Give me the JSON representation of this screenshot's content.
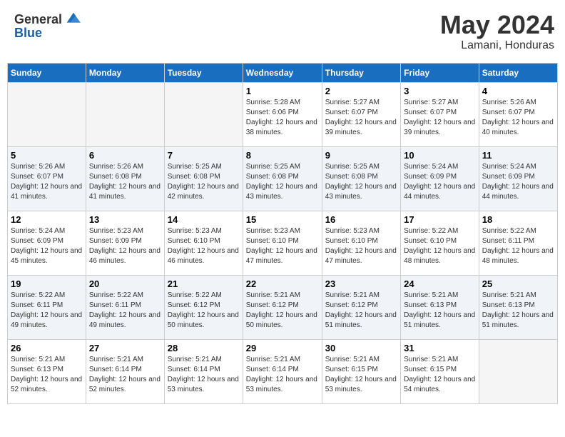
{
  "header": {
    "logo_general": "General",
    "logo_blue": "Blue",
    "month": "May 2024",
    "location": "Lamani, Honduras"
  },
  "weekdays": [
    "Sunday",
    "Monday",
    "Tuesday",
    "Wednesday",
    "Thursday",
    "Friday",
    "Saturday"
  ],
  "weeks": [
    [
      {
        "day": "",
        "sunrise": "",
        "sunset": "",
        "daylight": "",
        "empty": true
      },
      {
        "day": "",
        "sunrise": "",
        "sunset": "",
        "daylight": "",
        "empty": true
      },
      {
        "day": "",
        "sunrise": "",
        "sunset": "",
        "daylight": "",
        "empty": true
      },
      {
        "day": "1",
        "sunrise": "5:28 AM",
        "sunset": "6:06 PM",
        "daylight": "12 hours and 38 minutes."
      },
      {
        "day": "2",
        "sunrise": "5:27 AM",
        "sunset": "6:07 PM",
        "daylight": "12 hours and 39 minutes."
      },
      {
        "day": "3",
        "sunrise": "5:27 AM",
        "sunset": "6:07 PM",
        "daylight": "12 hours and 39 minutes."
      },
      {
        "day": "4",
        "sunrise": "5:26 AM",
        "sunset": "6:07 PM",
        "daylight": "12 hours and 40 minutes."
      }
    ],
    [
      {
        "day": "5",
        "sunrise": "5:26 AM",
        "sunset": "6:07 PM",
        "daylight": "12 hours and 41 minutes."
      },
      {
        "day": "6",
        "sunrise": "5:26 AM",
        "sunset": "6:08 PM",
        "daylight": "12 hours and 41 minutes."
      },
      {
        "day": "7",
        "sunrise": "5:25 AM",
        "sunset": "6:08 PM",
        "daylight": "12 hours and 42 minutes."
      },
      {
        "day": "8",
        "sunrise": "5:25 AM",
        "sunset": "6:08 PM",
        "daylight": "12 hours and 43 minutes."
      },
      {
        "day": "9",
        "sunrise": "5:25 AM",
        "sunset": "6:08 PM",
        "daylight": "12 hours and 43 minutes."
      },
      {
        "day": "10",
        "sunrise": "5:24 AM",
        "sunset": "6:09 PM",
        "daylight": "12 hours and 44 minutes."
      },
      {
        "day": "11",
        "sunrise": "5:24 AM",
        "sunset": "6:09 PM",
        "daylight": "12 hours and 44 minutes."
      }
    ],
    [
      {
        "day": "12",
        "sunrise": "5:24 AM",
        "sunset": "6:09 PM",
        "daylight": "12 hours and 45 minutes."
      },
      {
        "day": "13",
        "sunrise": "5:23 AM",
        "sunset": "6:09 PM",
        "daylight": "12 hours and 46 minutes."
      },
      {
        "day": "14",
        "sunrise": "5:23 AM",
        "sunset": "6:10 PM",
        "daylight": "12 hours and 46 minutes."
      },
      {
        "day": "15",
        "sunrise": "5:23 AM",
        "sunset": "6:10 PM",
        "daylight": "12 hours and 47 minutes."
      },
      {
        "day": "16",
        "sunrise": "5:23 AM",
        "sunset": "6:10 PM",
        "daylight": "12 hours and 47 minutes."
      },
      {
        "day": "17",
        "sunrise": "5:22 AM",
        "sunset": "6:10 PM",
        "daylight": "12 hours and 48 minutes."
      },
      {
        "day": "18",
        "sunrise": "5:22 AM",
        "sunset": "6:11 PM",
        "daylight": "12 hours and 48 minutes."
      }
    ],
    [
      {
        "day": "19",
        "sunrise": "5:22 AM",
        "sunset": "6:11 PM",
        "daylight": "12 hours and 49 minutes."
      },
      {
        "day": "20",
        "sunrise": "5:22 AM",
        "sunset": "6:11 PM",
        "daylight": "12 hours and 49 minutes."
      },
      {
        "day": "21",
        "sunrise": "5:22 AM",
        "sunset": "6:12 PM",
        "daylight": "12 hours and 50 minutes."
      },
      {
        "day": "22",
        "sunrise": "5:21 AM",
        "sunset": "6:12 PM",
        "daylight": "12 hours and 50 minutes."
      },
      {
        "day": "23",
        "sunrise": "5:21 AM",
        "sunset": "6:12 PM",
        "daylight": "12 hours and 51 minutes."
      },
      {
        "day": "24",
        "sunrise": "5:21 AM",
        "sunset": "6:13 PM",
        "daylight": "12 hours and 51 minutes."
      },
      {
        "day": "25",
        "sunrise": "5:21 AM",
        "sunset": "6:13 PM",
        "daylight": "12 hours and 51 minutes."
      }
    ],
    [
      {
        "day": "26",
        "sunrise": "5:21 AM",
        "sunset": "6:13 PM",
        "daylight": "12 hours and 52 minutes."
      },
      {
        "day": "27",
        "sunrise": "5:21 AM",
        "sunset": "6:14 PM",
        "daylight": "12 hours and 52 minutes."
      },
      {
        "day": "28",
        "sunrise": "5:21 AM",
        "sunset": "6:14 PM",
        "daylight": "12 hours and 53 minutes."
      },
      {
        "day": "29",
        "sunrise": "5:21 AM",
        "sunset": "6:14 PM",
        "daylight": "12 hours and 53 minutes."
      },
      {
        "day": "30",
        "sunrise": "5:21 AM",
        "sunset": "6:15 PM",
        "daylight": "12 hours and 53 minutes."
      },
      {
        "day": "31",
        "sunrise": "5:21 AM",
        "sunset": "6:15 PM",
        "daylight": "12 hours and 54 minutes."
      },
      {
        "day": "",
        "sunrise": "",
        "sunset": "",
        "daylight": "",
        "empty": true
      }
    ]
  ],
  "labels": {
    "sunrise": "Sunrise:",
    "sunset": "Sunset:",
    "daylight": "Daylight:"
  }
}
